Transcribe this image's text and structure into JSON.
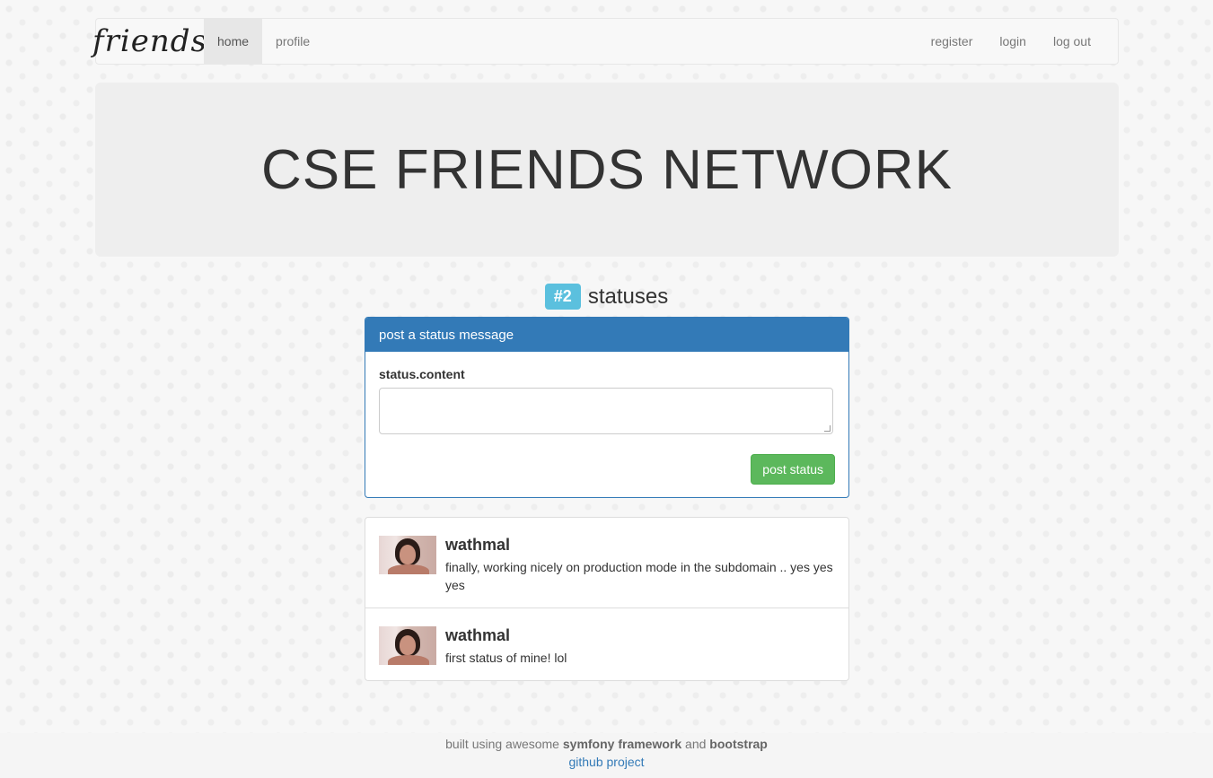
{
  "navbar": {
    "brand": "friends",
    "left_items": [
      {
        "label": "home",
        "active": true
      },
      {
        "label": "profile",
        "active": false
      }
    ],
    "right_items": [
      {
        "label": "register"
      },
      {
        "label": "login"
      },
      {
        "label": "log out"
      }
    ]
  },
  "jumbotron": {
    "title": "CSE FRIENDS NETWORK"
  },
  "statuses": {
    "badge": "#2",
    "label": "statuses"
  },
  "post_form": {
    "heading": "post a status message",
    "field_label": "status.content",
    "textarea_value": "",
    "submit_label": "post status"
  },
  "status_list": [
    {
      "username": "wathmal",
      "text": "finally, working nicely on production mode in the subdomain .. yes yes yes"
    },
    {
      "username": "wathmal",
      "text": "first status of mine! lol"
    }
  ],
  "footer": {
    "prefix": "built using awesome",
    "framework": "symfony framework",
    "and": "and",
    "bootstrap": "bootstrap",
    "link": "github project"
  },
  "colors": {
    "primary": "#337ab7",
    "success": "#5cb85c",
    "info_badge": "#5bc0de",
    "jumbotron_bg": "#eeeeee"
  }
}
